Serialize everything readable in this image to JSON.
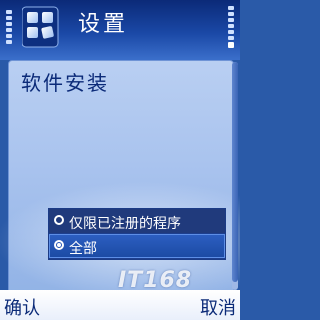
{
  "header": {
    "title": "设置",
    "icon": "settings-grid-icon"
  },
  "status": {
    "signal_icon": "signal-strength-icon",
    "battery_icon": "battery-level-icon"
  },
  "main": {
    "setting_label": "软件安装",
    "options": [
      {
        "label": "仅限已注册的程序",
        "selected": false
      },
      {
        "label": "全部",
        "selected": true
      }
    ]
  },
  "softkeys": {
    "left": "确认",
    "right": "取消"
  },
  "watermark": "IT168",
  "colors": {
    "title_bar": "#1a48a6",
    "panel": "#a9c3ee",
    "popup": "#1d3f8f",
    "softkey_text": "#0b2a78"
  }
}
